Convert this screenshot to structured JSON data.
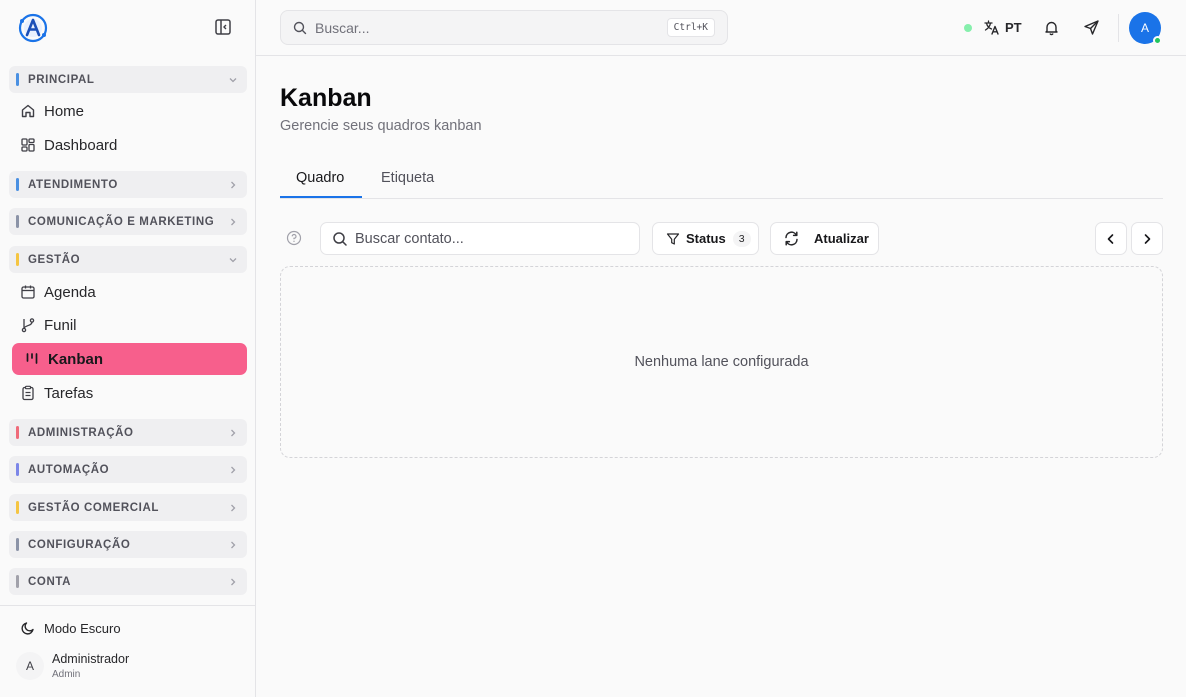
{
  "header": {
    "search_placeholder": "Buscar...",
    "search_shortcut": "Ctrl+K",
    "language": "PT",
    "user_initial": "A"
  },
  "sidebar": {
    "sections": {
      "principal": {
        "title": "PRINCIPAL",
        "color": "#4a90e2"
      },
      "atendimento": {
        "title": "ATENDIMENTO",
        "color": "#4a90e2"
      },
      "comunicacao": {
        "title": "COMUNICAÇÃO E MARKETING",
        "color": "#8b93a7"
      },
      "gestao": {
        "title": "GESTÃO",
        "color": "#f5c542"
      },
      "administracao": {
        "title": "ADMINISTRAÇÃO",
        "color": "#ef6b7a"
      },
      "automacao": {
        "title": "AUTOMAÇÃO",
        "color": "#7c86e8"
      },
      "gestao_comercial": {
        "title": "GESTÃO COMERCIAL",
        "color": "#f5c542"
      },
      "configuracao": {
        "title": "CONFIGURAÇÃO",
        "color": "#8b93a7"
      },
      "conta": {
        "title": "CONTA",
        "color": "#a1a1aa"
      }
    },
    "items": {
      "home": "Home",
      "dashboard": "Dashboard",
      "agenda": "Agenda",
      "funil": "Funil",
      "kanban": "Kanban",
      "tarefas": "Tarefas"
    },
    "dark_mode_label": "Modo Escuro",
    "user": {
      "initial": "A",
      "name": "Administrador",
      "role": "Admin"
    }
  },
  "page": {
    "title": "Kanban",
    "subtitle": "Gerencie seus quadros kanban",
    "tabs": [
      "Quadro",
      "Etiqueta"
    ],
    "contact_search_placeholder": "Buscar contato...",
    "status_label": "Status",
    "status_count": "3",
    "refresh_label": "Atualizar",
    "empty_message": "Nenhuma lane configurada"
  },
  "colors": {
    "accent": "#1a73e8",
    "active_item": "#f75f8c",
    "online": "#86efac"
  }
}
